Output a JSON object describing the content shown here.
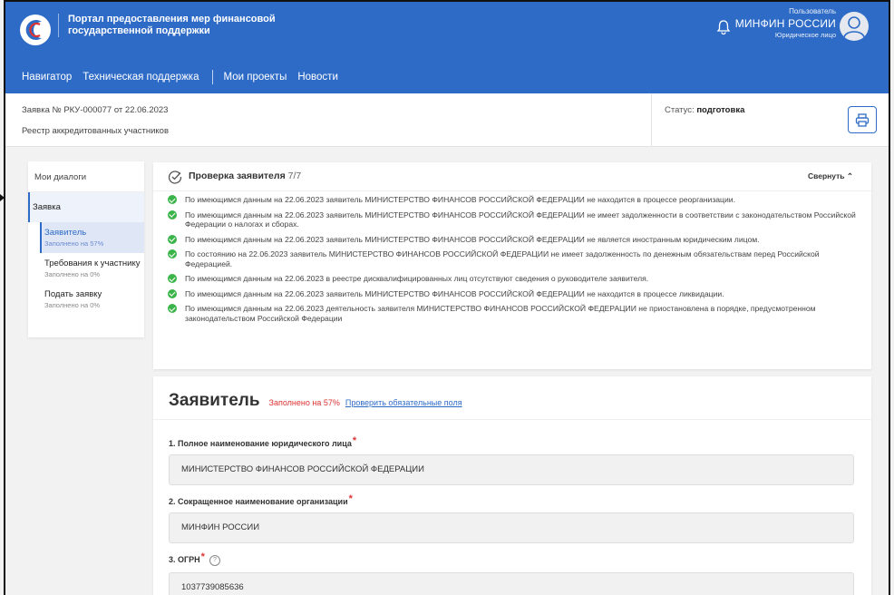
{
  "header": {
    "brand_title": "Портал предоставления мер финансовой государственной поддержки",
    "user_role": "Пользователь",
    "user_name": "МИНФИН РОССИИ",
    "user_type": "Юридическое лицо",
    "nav": [
      "Навигатор",
      "Техническая поддержка",
      "Мои проекты",
      "Новости"
    ]
  },
  "infobar": {
    "app_number": "Заявка № РКУ-000077 от 22.06.2023",
    "registry": "Реестр аккредитованных участников",
    "status_label": "Статус:",
    "status_value": "подготовка"
  },
  "sidebar": {
    "dialogs": "Мои диалоги",
    "zayavka": "Заявка",
    "items": [
      {
        "label": "Заявитель",
        "sub": "Заполнено на 57%"
      },
      {
        "label": "Требования к участнику",
        "sub": "Заполнено на 0%"
      },
      {
        "label": "Подать заявку",
        "sub": "Заполнено на 0%"
      }
    ]
  },
  "check": {
    "title": "Проверка заявителя",
    "count": "7/7",
    "collapse": "Свернуть",
    "items": [
      "По имеющимся данным на 22.06.2023 заявитель МИНИСТЕРСТВО ФИНАНСОВ РОССИЙСКОЙ ФЕДЕРАЦИИ не находится в процессе реорганизации.",
      "По имеющимся данным на 22.06.2023 заявитель МИНИСТЕРСТВО ФИНАНСОВ РОССИЙСКОЙ ФЕДЕРАЦИИ не имеет задолженности в соответствии с законодательством Российской Федерации о налогах и сборах.",
      "По имеющимся данным на 22.06.2023 заявитель МИНИСТЕРСТВО ФИНАНСОВ РОССИЙСКОЙ ФЕДЕРАЦИИ не является иностранным юридическим лицом.",
      "По состоянию на 22.06.2023 заявитель МИНИСТЕРСТВО ФИНАНСОВ РОССИЙСКОЙ ФЕДЕРАЦИИ не имеет задолженность по денежным обязательствам перед Российской Федерацией.",
      "По имеющимся данным на 22.06.2023 в реестре дисквалифицированных лиц отсутствуют сведения о руководителе заявителя.",
      "По имеющимся данным на 22.06.2023 заявитель МИНИСТЕРСТВО ФИНАНСОВ РОССИЙСКОЙ ФЕДЕРАЦИИ не находится в процессе ликвидации.",
      "По имеющимся данным на 22.06.2023 деятельность заявителя МИНИСТЕРСТВО ФИНАНСОВ РОССИЙСКОЙ ФЕДЕРАЦИИ не приостановлена в порядке, предусмотренном законодательством Российской Федерации"
    ]
  },
  "applicant": {
    "title": "Заявитель",
    "fill": "Заполнено на 57%",
    "check_link": "Проверить обязательные поля",
    "fields": [
      {
        "label": "1. Полное наименование юридического лица",
        "value": "МИНИСТЕРСТВО ФИНАНСОВ РОССИЙСКОЙ ФЕДЕРАЦИИ"
      },
      {
        "label": "2. Сокращенное наименование организации",
        "value": "МИНФИН РОССИИ"
      },
      {
        "label": "3. ОГРН",
        "value": "1037739085636"
      }
    ],
    "help": "?",
    "required_mark": "*"
  },
  "colors": {
    "header": "#2e6bc7",
    "success": "#3bb54a",
    "required": "#d33"
  }
}
